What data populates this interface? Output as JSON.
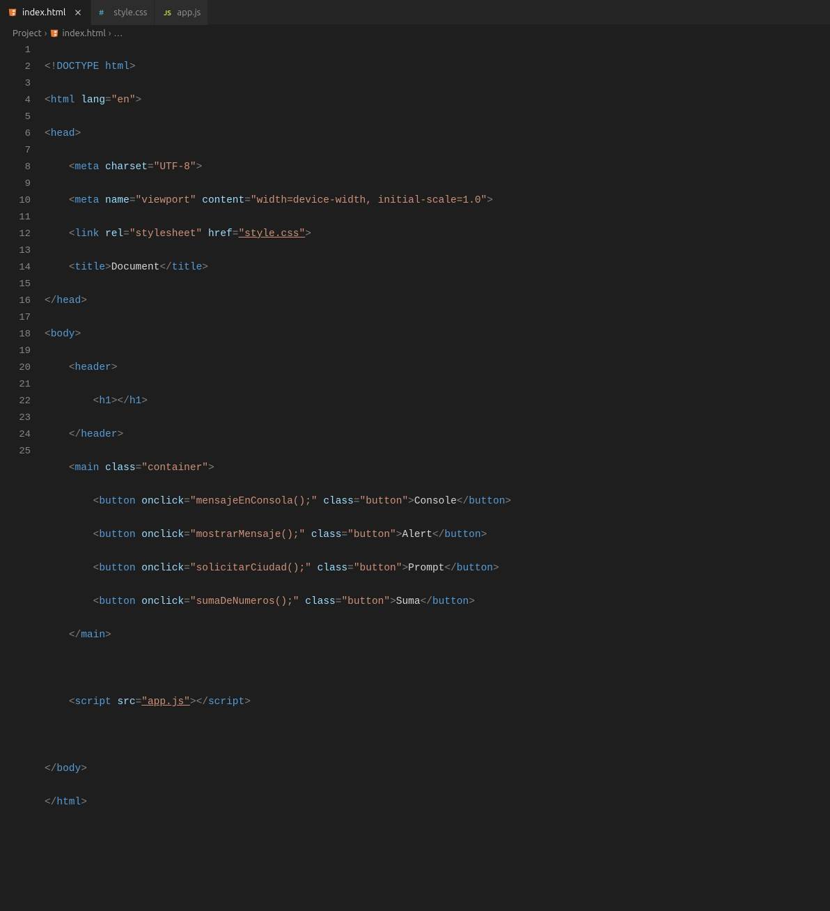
{
  "tabs": [
    {
      "label": "index.html",
      "icon": "html"
    },
    {
      "label": "style.css",
      "icon": "css"
    },
    {
      "label": "app.js",
      "icon": "js"
    }
  ],
  "breadcrumb": {
    "root": "Project",
    "file": "index.html",
    "ellipsis": "…"
  },
  "code": {
    "doctype": "DOCTYPE",
    "html_kw": "html",
    "lang_attr": "lang",
    "lang_val": "\"en\"",
    "head": "head",
    "meta": "meta",
    "charset_attr": "charset",
    "charset_val": "\"UTF-8\"",
    "name_attr": "name",
    "name_val": "\"viewport\"",
    "content_attr": "content",
    "content_val": "\"width=device-width, initial-scale=1.0\"",
    "link": "link",
    "rel_attr": "rel",
    "rel_val": "\"stylesheet\"",
    "href_attr": "href",
    "href_val": "\"style.css\"",
    "title": "title",
    "title_text": "Document",
    "body": "body",
    "header": "header",
    "h1": "h1",
    "main": "main",
    "class_attr": "class",
    "container_val": "\"container\"",
    "button": "button",
    "onclick_attr": "onclick",
    "button_class_val": "\"button\"",
    "btn1_onclick": "\"mensajeEnConsola();\"",
    "btn1_text": "Console",
    "btn2_onclick": "\"mostrarMensaje();\"",
    "btn2_text": "Alert",
    "btn3_onclick": "\"solicitarCiudad();\"",
    "btn3_text": "Prompt",
    "btn4_onclick": "\"sumaDeNumeros();\"",
    "btn4_text": "Suma",
    "script": "script",
    "src_attr": "src",
    "src_val": "\"app.js\""
  },
  "line_count": 25
}
